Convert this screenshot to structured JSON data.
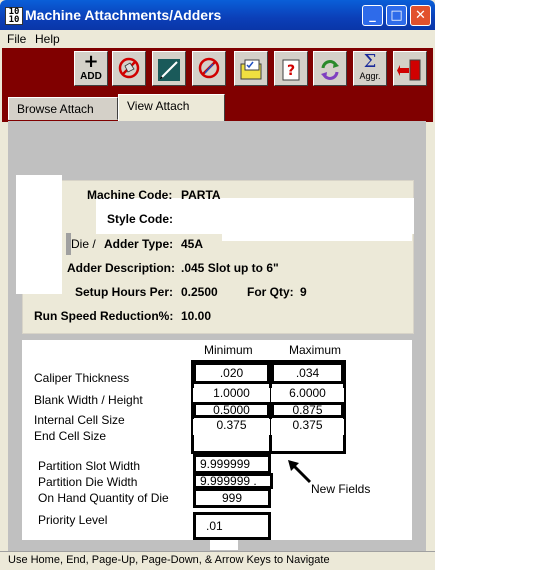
{
  "window": {
    "icon_text": "10 10",
    "title": "Machine Attachments/Adders",
    "minimize": "_",
    "maximize": "□",
    "close": "✕"
  },
  "menu": {
    "file": "File",
    "help": "Help"
  },
  "toolbar": {
    "add_plus": "+",
    "add_label": "ADD",
    "aggr_symbol": "Σ",
    "aggr_label": "Aggr."
  },
  "tabs": {
    "browse": "Browse Attach",
    "view": "View Attach"
  },
  "details": {
    "machine_code_label": "Machine Code:",
    "machine_code_value": "PARTA",
    "style_code_label": "Style Code:",
    "die_label": "Die /",
    "adder_type_label": "Adder Type:",
    "adder_type_value": "45A",
    "adder_desc_label": "Adder Description:",
    "adder_desc_value": ".045 Slot up to 6\"",
    "setup_hours_label": "Setup Hours Per:",
    "setup_hours_value": "0.2500",
    "for_qty_label": "For Qty:",
    "for_qty_value": "9",
    "run_speed_label": "Run Speed Reduction%:",
    "run_speed_value": "10.00"
  },
  "measurements": {
    "min_header": "Minimum",
    "max_header": "Maximum",
    "caliper_label": "Caliper Thickness",
    "caliper_min": ".020",
    "caliper_max": ".034",
    "blank_label": "Blank Width / Height",
    "blank_min": "1.0000",
    "blank_max": "6.0000",
    "internal_label": "Internal Cell Size",
    "internal_min": "0.5000",
    "internal_max": "0.875",
    "end_label": "End Cell Size",
    "end_min": "0.375",
    "end_max": "0.375",
    "partition_slot_label": "Partition Slot Width",
    "partition_slot_value": "9.999999",
    "partition_die_label": "Partition Die Width",
    "partition_die_value": "9.999999 .",
    "on_hand_label": "On Hand Quantity of Die",
    "on_hand_value": "999",
    "priority_label": "Priority Level",
    "priority_value": ".01",
    "annotation": "New Fields"
  },
  "status_bar": "Use Home, End, Page-Up, Page-Down, & Arrow Keys to Navigate"
}
